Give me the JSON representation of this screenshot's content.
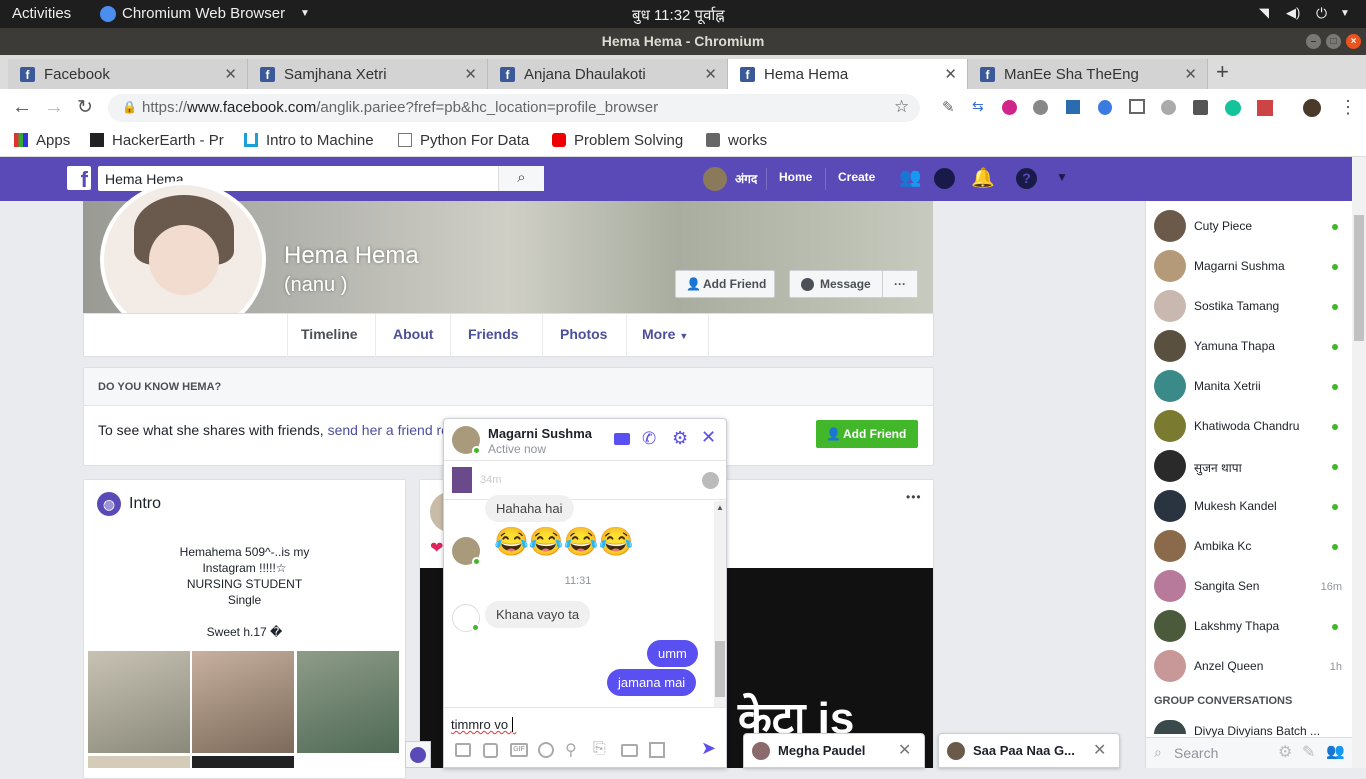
{
  "system": {
    "activities": "Activities",
    "app": "Chromium Web Browser",
    "clock": "बुध 11:32 पूर्वाह्न"
  },
  "window": {
    "title": "Hema Hema - Chromium"
  },
  "tabs": [
    {
      "label": "Facebook"
    },
    {
      "label": "Samjhana Xetri"
    },
    {
      "label": "Anjana Dhaulakoti"
    },
    {
      "label": "Hema Hema"
    },
    {
      "label": "ManEe Sha TheEng"
    }
  ],
  "url": {
    "scheme": "https://",
    "host": "www.facebook.com",
    "path": "/anglik.pariee?fref=pb&hc_location=profile_browser"
  },
  "bookmarks": [
    {
      "label": "Apps"
    },
    {
      "label": "HackerEarth - Pr"
    },
    {
      "label": "Intro to Machine"
    },
    {
      "label": "Python For Data"
    },
    {
      "label": "Problem Solving"
    },
    {
      "label": "works"
    }
  ],
  "fb": {
    "search_value": "Hema Hema",
    "user": "अंगद",
    "home": "Home",
    "create": "Create"
  },
  "profile": {
    "name": "Hema Hema",
    "nickname": "(nanu )",
    "add_friend": "Add Friend",
    "message": "Message",
    "more_dots": "···",
    "nav": [
      "Timeline",
      "About",
      "Friends",
      "Photos",
      "More"
    ]
  },
  "know": {
    "heading": "DO YOU KNOW HEMA?",
    "text": "To see what she shares with friends, ",
    "link": "send her a friend re",
    "button": "Add Friend"
  },
  "intro": {
    "title": "Intro",
    "lines": [
      "Hemahema 509^-..is my",
      "Instagram !!!!!☆",
      "NURSING STUDENT",
      "Single",
      "",
      "Sweet h.17 �"
    ]
  },
  "post": {
    "dots": "•••",
    "big_text": "केटा is"
  },
  "chat": {
    "name": "Magarni Sushma",
    "status": "Active now",
    "prev_time": "34m",
    "messages": [
      {
        "side": "left",
        "text": "Hahaha hai"
      },
      {
        "side": "left",
        "text": "😂😂😂😂"
      },
      {
        "side": "time",
        "text": "11:31"
      },
      {
        "side": "left",
        "text": "Khana vayo ta"
      },
      {
        "side": "right",
        "text": "umm"
      },
      {
        "side": "right",
        "text": "jamana mai"
      }
    ],
    "input": "timmro vo "
  },
  "minichats": [
    {
      "label": "Megha Paudel"
    },
    {
      "label": "Saa Paa Naa G..."
    }
  ],
  "contacts": [
    {
      "name": "Cuty Piece",
      "status": "online",
      "color": "#6b5a4a"
    },
    {
      "name": "Magarni Sushma",
      "status": "online",
      "color": "#b59a7a"
    },
    {
      "name": "Sostika Tamang",
      "status": "online",
      "color": "#c8b8b0"
    },
    {
      "name": "Yamuna Thapa",
      "status": "online",
      "color": "#5a5040"
    },
    {
      "name": "Manita Xetrii",
      "status": "online",
      "color": "#3a8a8a"
    },
    {
      "name": "Khatiwoda Chandru",
      "status": "online",
      "color": "#7a7a30"
    },
    {
      "name": "सुजन थापा",
      "status": "online",
      "color": "#2a2a2a"
    },
    {
      "name": "Mukesh Kandel",
      "status": "online",
      "color": "#2a3440"
    },
    {
      "name": "Ambika Kc",
      "status": "online",
      "color": "#8a6a4a"
    },
    {
      "name": "Sangita Sen",
      "status": "16m",
      "color": "#b87a9a"
    },
    {
      "name": "Lakshmy Thapa",
      "status": "online",
      "color": "#4a5a3a"
    },
    {
      "name": "Anzel Queen",
      "status": "1h",
      "color": "#c89898"
    }
  ],
  "group_heading": "GROUP CONVERSATIONS",
  "group_item": "Divya Divyians Batch ...",
  "sidebar_search": "Search",
  "colors": {
    "fb_purple": "#5a4ab8",
    "green": "#42b72a",
    "online": "#42b72a",
    "messenger_blue": "#5a4ff0"
  }
}
